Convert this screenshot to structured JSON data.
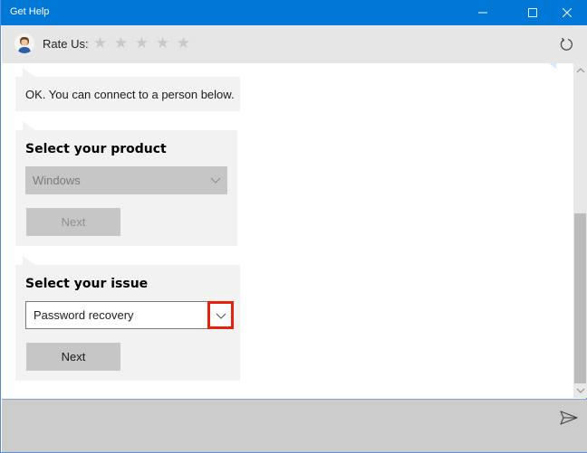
{
  "window": {
    "title": "Get Help",
    "controls": {
      "minimize": "minimize-icon",
      "maximize": "maximize-icon",
      "close": "close-icon"
    }
  },
  "header": {
    "rate_label": "Rate Us:",
    "stars": [
      "★",
      "★",
      "★",
      "★",
      "★"
    ],
    "rating": 0,
    "refresh_icon": "refresh-icon"
  },
  "conversation": {
    "message": "OK. You can connect to a person below.",
    "product_card": {
      "title": "Select your product",
      "selected_value": "Windows",
      "next_label": "Next",
      "state": "disabled"
    },
    "issue_card": {
      "title": "Select your issue",
      "selected_value": "Password recovery",
      "next_label": "Next",
      "state": "enabled"
    }
  },
  "footer": {
    "send_icon": "send-icon"
  },
  "colors": {
    "accent": "#0078d7",
    "highlight": "#e8220a",
    "bubble": "#f2f2f2",
    "header": "#e6e6e6"
  }
}
